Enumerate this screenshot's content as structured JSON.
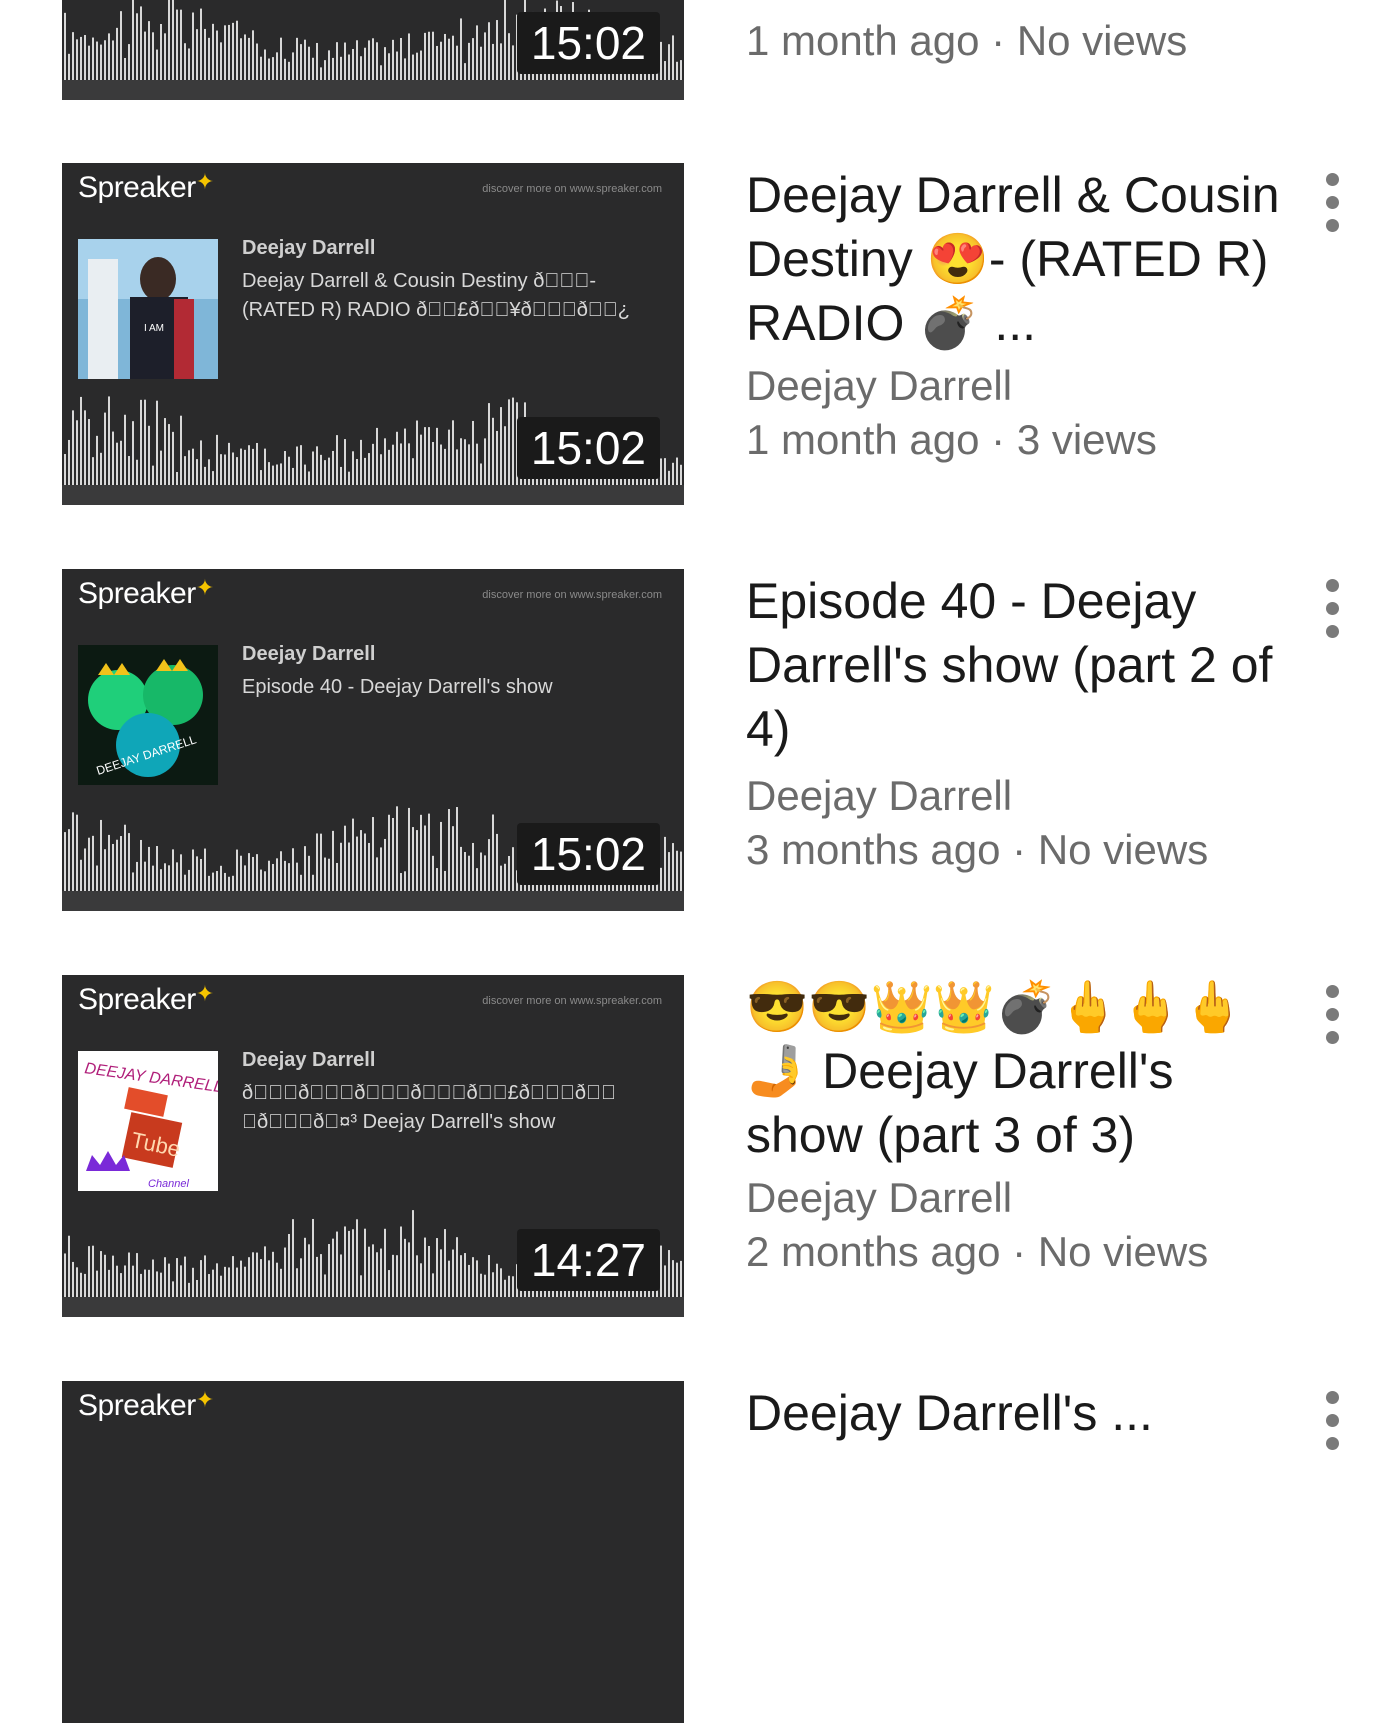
{
  "brand": "Spreaker",
  "discover_text": "discover more on www.spreaker.com",
  "items": [
    {
      "duration": "15:02",
      "title": "",
      "channel": "",
      "meta": "1 month ago · No views"
    },
    {
      "duration": "15:02",
      "thumb_author": "Deejay Darrell",
      "thumb_title": "Deejay Darrell & Cousin Destiny ð\u0000\u0000\u0000- (RATED R) RADIO ð\u0000\u0000£ð\u0000\u0000¥ð\u0000\u0000\u0000ð\u0000\u0000¿",
      "title": "Deejay Darrell & Cousin Destiny 😍- (RATED R) RADIO 💣 ...",
      "channel": "Deejay Darrell",
      "meta": "1 month ago · 3 views"
    },
    {
      "duration": "15:02",
      "thumb_author": "Deejay Darrell",
      "thumb_title": "Episode 40 - Deejay Darrell's show",
      "title": "Episode 40 - Deejay Darrell's show (part 2 of 4)",
      "channel": "Deejay Darrell",
      "meta": "3 months ago · No views"
    },
    {
      "duration": "14:27",
      "thumb_author": "Deejay Darrell",
      "thumb_title": "ð\u0000\u0000\u0000ð\u0000\u0000\u0000ð\u0000\u0000\u0000ð\u0000\u0000\u0000ð\u0000\u0000£ð\u0000\u0000\u0000ð\u0000\u0000 \u0000ð\u0000\u0000\u0000ð\u0000¤³ Deejay Darrell's show",
      "title": "😎😎👑👑💣🖕🖕🖕🤳 Deejay Darrell's show (part 3 of 3)",
      "channel": "Deejay Darrell",
      "meta": "2 months ago · No views"
    },
    {
      "title": "Deejay Darrell's ...",
      "channel": "",
      "meta": ""
    }
  ]
}
